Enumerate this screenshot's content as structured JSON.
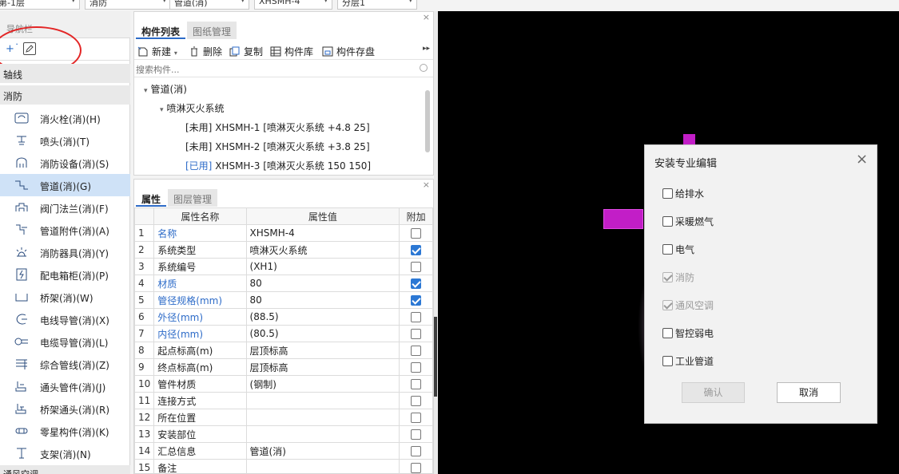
{
  "top_dropdowns": [
    "第-1层",
    "消防",
    "管道(消)",
    "XHSMH-4",
    "分层1"
  ],
  "nav": {
    "title": "导航栏",
    "close": "×",
    "tools": {
      "add_icon": "add-sparkle-icon",
      "edit_icon": "edit-icon"
    },
    "category_axis": "轴线",
    "category_fire": "消防",
    "items": [
      {
        "label": "消火栓(消)(H)",
        "icon": "hydrant-icon"
      },
      {
        "label": "喷头(消)(T)",
        "icon": "sprinkler-icon"
      },
      {
        "label": "消防设备(消)(S)",
        "icon": "fire-equipment-icon"
      },
      {
        "label": "管道(消)(G)",
        "icon": "pipe-icon"
      },
      {
        "label": "阀门法兰(消)(F)",
        "icon": "valve-icon"
      },
      {
        "label": "管道附件(消)(A)",
        "icon": "pipe-fitting-icon"
      },
      {
        "label": "消防器具(消)(Y)",
        "icon": "fire-apparatus-icon"
      },
      {
        "label": "配电箱柜(消)(P)",
        "icon": "distribution-box-icon"
      },
      {
        "label": "桥架(消)(W)",
        "icon": "cable-tray-icon"
      },
      {
        "label": "电线导管(消)(X)",
        "icon": "wire-conduit-icon"
      },
      {
        "label": "电缆导管(消)(L)",
        "icon": "cable-conduit-icon"
      },
      {
        "label": "综合管线(消)(Z)",
        "icon": "combined-pipeline-icon"
      },
      {
        "label": "通头管件(消)(J)",
        "icon": "tee-fitting-icon"
      },
      {
        "label": "桥架通头(消)(R)",
        "icon": "tray-tee-icon"
      },
      {
        "label": "零星构件(消)(K)",
        "icon": "misc-component-icon"
      },
      {
        "label": "支架(消)(N)",
        "icon": "bracket-icon"
      }
    ],
    "category_next": "通风空调"
  },
  "component_panel": {
    "tabs": [
      "构件列表",
      "图纸管理"
    ],
    "close": "×",
    "toolbar": {
      "new": "新建",
      "delete": "删除",
      "copy": "复制",
      "library": "构件库",
      "save": "构件存盘",
      "more": "▸▸"
    },
    "search_placeholder": "搜索构件...",
    "tree": {
      "root": "管道(消)",
      "group": "喷淋灭火系统",
      "items": [
        {
          "status": "[未用]",
          "text": "XHSMH-1 [喷淋灭火系统 +4.8 25]"
        },
        {
          "status": "[未用]",
          "text": "XHSMH-2 [喷淋灭火系统 +3.8 25]"
        },
        {
          "status": "[已用]",
          "text": "XHSMH-3 [喷淋灭火系统 150 150]"
        }
      ]
    }
  },
  "property_panel": {
    "tabs": [
      "属性",
      "图层管理"
    ],
    "close": "×",
    "headers": [
      "属性名称",
      "属性值",
      "附加"
    ],
    "rows": [
      {
        "num": "1",
        "name": "名称",
        "value": "XHSMH-4",
        "blue": true,
        "check": null
      },
      {
        "num": "2",
        "name": "系统类型",
        "value": "喷淋灭火系统",
        "blue": false,
        "check": true
      },
      {
        "num": "3",
        "name": "系统编号",
        "value": "(XH1)",
        "blue": false,
        "check": false
      },
      {
        "num": "4",
        "name": "材质",
        "value": "80",
        "blue": true,
        "check": true
      },
      {
        "num": "5",
        "name": "管径规格(mm)",
        "value": "80",
        "blue": true,
        "check": true
      },
      {
        "num": "6",
        "name": "外径(mm)",
        "value": "(88.5)",
        "blue": true,
        "check": false
      },
      {
        "num": "7",
        "name": "内径(mm)",
        "value": "(80.5)",
        "blue": true,
        "check": false
      },
      {
        "num": "8",
        "name": "起点标高(m)",
        "value": "层顶标高",
        "blue": false,
        "check": false
      },
      {
        "num": "9",
        "name": "终点标高(m)",
        "value": "层顶标高",
        "blue": false,
        "check": false
      },
      {
        "num": "10",
        "name": "管件材质",
        "value": "(钢制)",
        "blue": false,
        "check": false
      },
      {
        "num": "11",
        "name": "连接方式",
        "value": "",
        "blue": false,
        "check": false
      },
      {
        "num": "12",
        "name": "所在位置",
        "value": "",
        "blue": false,
        "check": false
      },
      {
        "num": "13",
        "name": "安装部位",
        "value": "",
        "blue": false,
        "check": false
      },
      {
        "num": "14",
        "name": "汇总信息",
        "value": "管道(消)",
        "blue": false,
        "check": false
      },
      {
        "num": "15",
        "name": "备注",
        "value": "",
        "blue": false,
        "check": false
      }
    ]
  },
  "dialog": {
    "title": "安装专业编辑",
    "close": "×",
    "options": [
      {
        "label": "给排水",
        "checked": false,
        "disabled": false
      },
      {
        "label": "采暖燃气",
        "checked": false,
        "disabled": false
      },
      {
        "label": "电气",
        "checked": false,
        "disabled": false
      },
      {
        "label": "消防",
        "checked": true,
        "disabled": true
      },
      {
        "label": "通风空调",
        "checked": true,
        "disabled": true
      },
      {
        "label": "智控弱电",
        "checked": false,
        "disabled": false
      },
      {
        "label": "工业管道",
        "checked": false,
        "disabled": false
      }
    ],
    "confirm": "确认",
    "cancel": "取消"
  },
  "colors": {
    "accent": "#2d6bc8",
    "selected_row": "#cfe2f7",
    "pipe_magenta": "#c21ec7",
    "annotation_red": "#e32626"
  }
}
